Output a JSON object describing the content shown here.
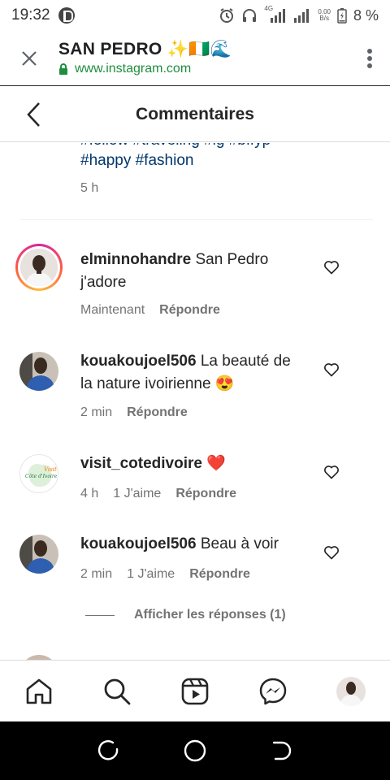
{
  "status_bar": {
    "time": "19:32",
    "net_type": "4G",
    "speed_value": "0.00",
    "speed_unit": "B/s",
    "battery": "8 %"
  },
  "browser_tab": {
    "title": "SAN PEDRO ✨🇨🇮🌊",
    "url": "www.instagram.com"
  },
  "ig_header": {
    "title": "Commentaires"
  },
  "caption": {
    "cut_line": "#follow #traveling #ig #bffyp",
    "tags": "#happy #fashion",
    "time": "5 h"
  },
  "comments": [
    {
      "username": "elminnohandre",
      "text": "San Pedro j'adore",
      "time": "Maintenant",
      "likes": "",
      "reply_label": "Répondre",
      "avatar": "profile-photo-man-white-shirt",
      "story_ring": true
    },
    {
      "username": "kouakoujoel506",
      "text": "La beauté de la nature ivoirienne 😍",
      "time": "2 min",
      "likes": "",
      "reply_label": "Répondre",
      "avatar": "profile-photo-man-blue-shirt",
      "story_ring": false
    },
    {
      "username": "visit_cotedivoire",
      "text": "❤️",
      "time": "4 h",
      "likes": "1 J'aime",
      "reply_label": "Répondre",
      "avatar": "visit-cote-divoire-logo",
      "avatar_text": "Côte d'Ivoire",
      "avatar_text_top": "Visit",
      "story_ring": false
    },
    {
      "username": "kouakoujoel506",
      "text": "Beau à voir",
      "time": "2 min",
      "likes": "1 J'aime",
      "reply_label": "Répondre",
      "avatar": "profile-photo-man-blue-shirt",
      "story_ring": false
    }
  ],
  "view_replies": {
    "label": "Afficher les réponses (1)"
  },
  "bottom_nav": {
    "items": [
      "home-icon",
      "search-icon",
      "reels-icon",
      "messenger-icon",
      "profile-avatar"
    ]
  },
  "colors": {
    "link": "#00376b",
    "secondary_text": "#737373",
    "url_green": "#1e8e3e",
    "heart_red": "#e0245e",
    "divider": "#dbdbdb"
  }
}
